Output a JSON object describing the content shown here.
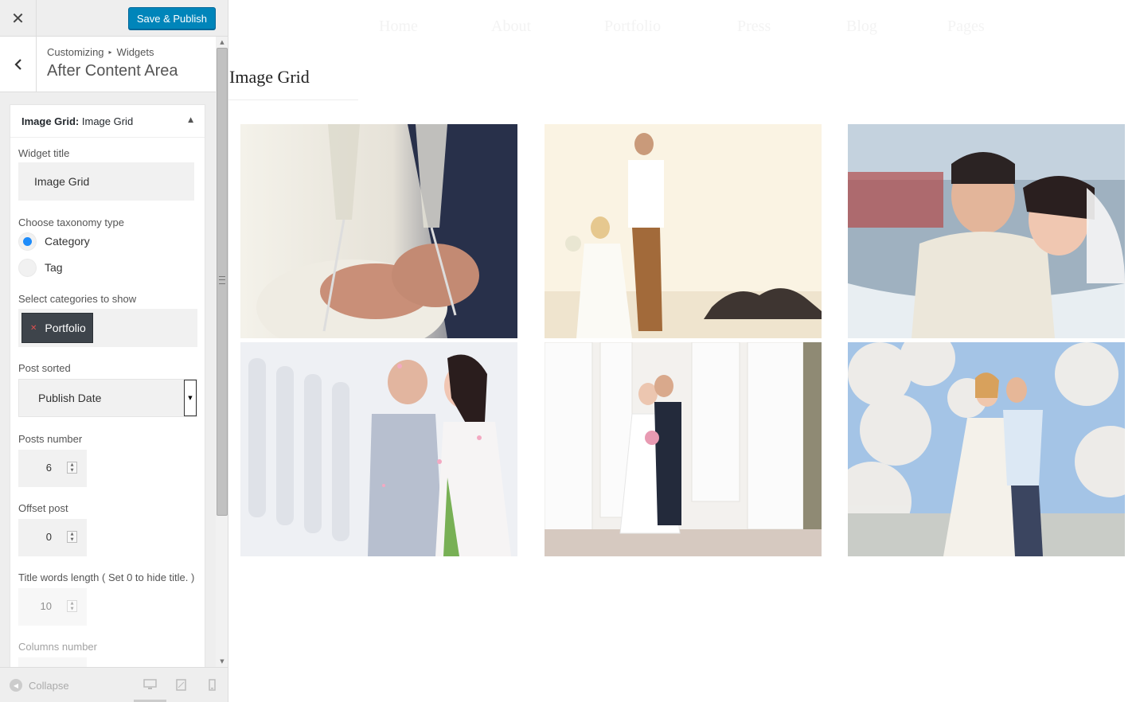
{
  "topbar": {
    "save_label": "Save & Publish"
  },
  "section": {
    "breadcrumb": [
      "Customizing",
      "Widgets"
    ],
    "title": "After Content Area"
  },
  "widget": {
    "header_type": "Image Grid:",
    "header_name": "Image Grid",
    "title_label": "Widget title",
    "title_value": "Image Grid",
    "taxonomy_label": "Choose taxonomy type",
    "taxonomy_options": [
      {
        "label": "Category",
        "selected": true
      },
      {
        "label": "Tag",
        "selected": false
      }
    ],
    "categories_label": "Select categories to show",
    "categories": [
      "Portfolio"
    ],
    "sort_label": "Post sorted",
    "sort_value": "Publish Date",
    "posts_number_label": "Posts number",
    "posts_number": "6",
    "offset_label": "Offset post",
    "offset": "0",
    "title_words_label": "Title words length ( Set 0 to hide title. )",
    "title_words": "10",
    "columns_label": "Columns number"
  },
  "footer": {
    "collapse_label": "Collapse"
  },
  "preview": {
    "nav": [
      "Home",
      "About",
      "Portfolio",
      "Press",
      "Blog",
      "Pages"
    ],
    "grid_title": "Image Grid",
    "tiles": [
      {
        "alt": "champagne-toast"
      },
      {
        "alt": "beach-walk"
      },
      {
        "alt": "car-couple"
      },
      {
        "alt": "petals-kiss"
      },
      {
        "alt": "column-hall"
      },
      {
        "alt": "blossom-embrace"
      }
    ]
  },
  "colors": {
    "accent": "#0085ba",
    "radio": "#1e8cfa",
    "chip": "#3e444b"
  }
}
